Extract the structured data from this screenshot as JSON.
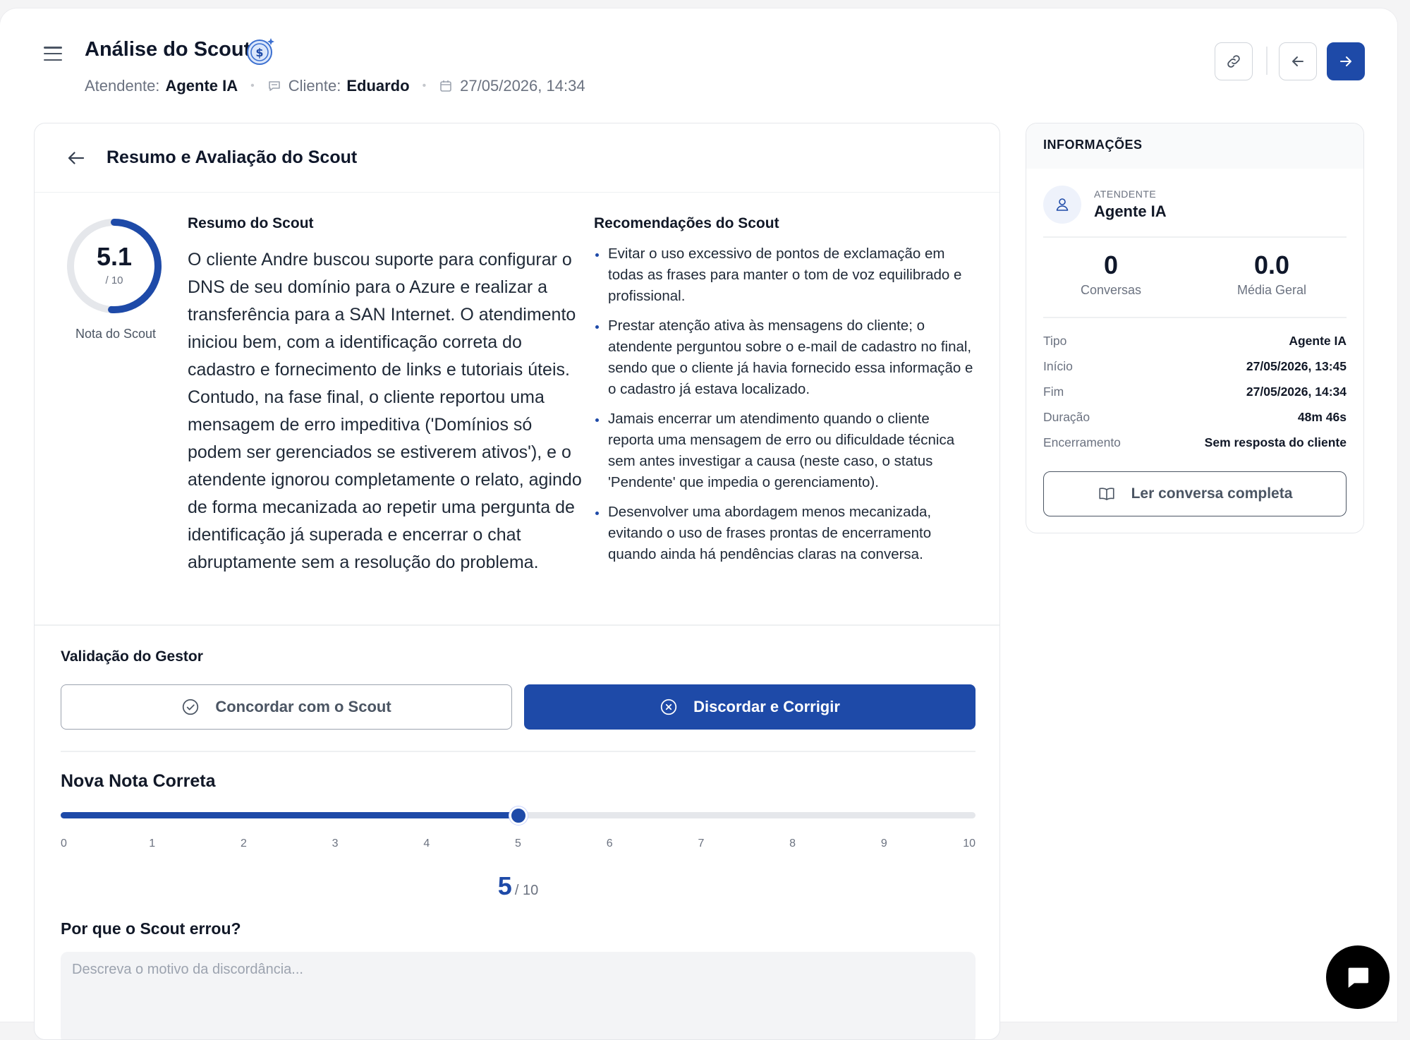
{
  "header": {
    "title": "Análise do Scout",
    "atendente_label": "Atendente:",
    "atendente_value": "Agente IA",
    "cliente_label": "Cliente:",
    "cliente_value": "Eduardo",
    "datetime": "27/05/2026, 14:34"
  },
  "card": {
    "title": "Resumo e Avaliação do Scout",
    "score": {
      "value": "5.1",
      "denominator": "/ 10",
      "label": "Nota do Scout",
      "fraction": 0.51
    },
    "summary_title": "Resumo do Scout",
    "summary_text": "O cliente Andre buscou suporte para configurar o DNS de seu domínio para o Azure e realizar a transferência para a SAN Internet. O atendimento iniciou bem, com a identificação correta do cadastro e fornecimento de links e tutoriais úteis. Contudo, na fase final, o cliente reportou uma mensagem de erro impeditiva ('Domínios só podem ser gerenciados se estiverem ativos'), e o atendente ignorou completamente o relato, agindo de forma mecanizada ao repetir uma pergunta de identificação já superada e encerrar o chat abruptamente sem a resolução do problema.",
    "reco_title": "Recomendações do Scout",
    "recommendations": [
      "Evitar o uso excessivo de pontos de exclamação em todas as frases para manter o tom de voz equilibrado e profissional.",
      "Prestar atenção ativa às mensagens do cliente; o atendente perguntou sobre o e-mail de cadastro no final, sendo que o cliente já havia fornecido essa informação e o cadastro já estava localizado.",
      "Jamais encerrar um atendimento quando o cliente reporta uma mensagem de erro ou dificuldade técnica sem antes investigar a causa (neste caso, o status 'Pendente' que impedia o gerenciamento).",
      "Desenvolver uma abordagem menos mecanizada, evitando o uso de frases prontas de encerramento quando ainda há pendências claras na conversa."
    ]
  },
  "validation": {
    "title": "Validação do Gestor",
    "agree_label": "Concordar com o Scout",
    "disagree_label": "Discordar e Corrigir",
    "new_score_title": "Nova Nota Correta",
    "slider": {
      "min": 0,
      "max": 10,
      "value": 5,
      "ticks": [
        "0",
        "1",
        "2",
        "3",
        "4",
        "5",
        "6",
        "7",
        "8",
        "9",
        "10"
      ]
    },
    "value_display": "5",
    "value_den": "/ 10",
    "why_title": "Por que o Scout errou?",
    "why_placeholder": "Descreva o motivo da discordância..."
  },
  "side": {
    "title": "INFORMAÇÕES",
    "att_caption": "ATENDENTE",
    "att_name": "Agente IA",
    "stats": [
      {
        "value": "0",
        "label": "Conversas"
      },
      {
        "value": "0.0",
        "label": "Média Geral"
      }
    ],
    "details": [
      {
        "key": "Tipo",
        "value": "Agente IA"
      },
      {
        "key": "Início",
        "value": "27/05/2026, 13:45"
      },
      {
        "key": "Fim",
        "value": "27/05/2026, 14:34"
      },
      {
        "key": "Duração",
        "value": "48m 46s"
      },
      {
        "key": "Encerramento",
        "value": "Sem resposta do cliente"
      }
    ],
    "read_button": "Ler conversa completa"
  },
  "colors": {
    "primary": "#1e4aa8",
    "ring_track": "#e5e7eb"
  },
  "icons": [
    "menu-icon",
    "dollar-badge-icon",
    "chat-icon",
    "calendar-icon",
    "link-icon",
    "arrow-left-icon",
    "arrow-right-icon",
    "check-circle-icon",
    "x-circle-icon",
    "user-icon",
    "book-icon",
    "chat-bubble-icon"
  ]
}
